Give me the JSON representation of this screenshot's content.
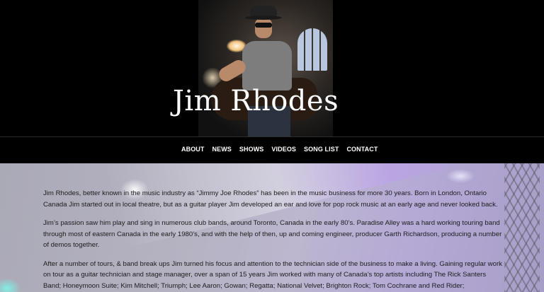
{
  "site": {
    "title": "Jim Rhodes"
  },
  "nav": {
    "items": [
      "ABOUT",
      "NEWS",
      "SHOWS",
      "VIDEOS",
      "SONG LIST",
      "CONTACT"
    ]
  },
  "about": {
    "paragraphs": [
      "Jim Rhodes, better known in the music industry as “Jimmy Joe Rhodes” has been in the music business for more 30 years. Born in London, Ontario Canada Jim started out in local theatre, but as a guitar player Jim developed an ear and love for pop rock music at an early age and never looked back.",
      "Jim’s passion saw him play and sing in numerous club bands, around Toronto, Canada in the early 80’s. Paradise Alley was a hard working touring band through most of eastern Canada in the early 1980’s, and with the help of then, up and coming engineer, producer Garth Richardson, producing a number of demos together.",
      "After a number of tours, & band break ups Jim turned his focus and attention to the technician side of the business to make a living. Gaining regular work on tour as a guitar technician and stage manager, over a span of 15 years Jim worked with many of Canada’s top artists including The Rick Santers Band; Honeymoon Suite; Kim Mitchell; Triumph; Lee Aaron; Gowan; Regatta; National Velvet; Brighton Rock; Tom Cochrane and Red Rider;"
    ]
  }
}
